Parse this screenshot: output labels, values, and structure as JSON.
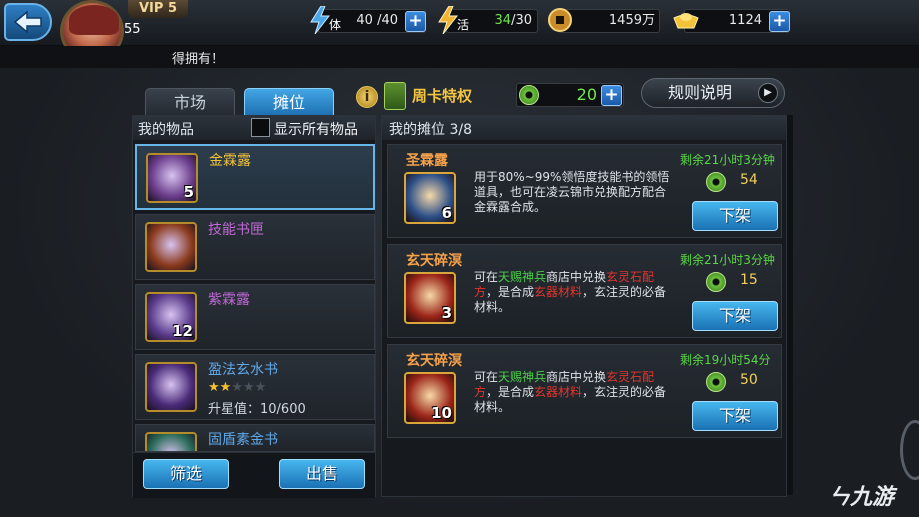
{
  "player": {
    "vip": "VIP 5",
    "level": "55"
  },
  "resources": {
    "stamina": {
      "icon": "stamina-icon",
      "label": "体",
      "value": "40 /40"
    },
    "vitality": {
      "icon": "vitality-icon",
      "label": "活",
      "current": "34",
      "max": "/30"
    },
    "copper": {
      "icon": "copper-coin-icon",
      "value": "1459万"
    },
    "gold": {
      "icon": "gold-ingot-icon",
      "value": "1124"
    }
  },
  "marquee": {
    "text": "得拥有！"
  },
  "tabs": [
    {
      "label": "市场",
      "active": false
    },
    {
      "label": "摊位",
      "active": true
    }
  ],
  "weekly_card": {
    "label": "周卡特权"
  },
  "jade_balance": {
    "value": "20"
  },
  "rules_button": {
    "label": "规则说明"
  },
  "left_panel": {
    "title": "我的物品",
    "show_all_label": "显示所有物品",
    "items": [
      {
        "name": "金霖露",
        "count": "5",
        "color": "#f4c33a",
        "selected": true,
        "icon_color": "#6a3c8a"
      },
      {
        "name": "技能书匣",
        "count": "",
        "color": "#c06ad6",
        "selected": false,
        "icon_color": "#8a3a1c"
      },
      {
        "name": "紫霖露",
        "count": "12",
        "color": "#c06ad6",
        "selected": false,
        "icon_color": "#5a3a8a"
      },
      {
        "name": "盈法玄水书",
        "count": "",
        "color": "#5fa8e8",
        "selected": false,
        "icon_color": "#4a2a78",
        "stars_on": 2,
        "stars_total": 5,
        "sub": "升星值：10/600"
      },
      {
        "name": "固盾素金书",
        "count": "",
        "color": "#5fa8e8",
        "selected": false,
        "icon_color": "#2a6a58"
      }
    ],
    "filter_button": "筛选",
    "sell_button": "出售"
  },
  "right_panel": {
    "title": "我的摊位 3/8",
    "stalls": [
      {
        "name": "圣霖露",
        "count": "6",
        "icon_color": "#2c4f88",
        "remain": "剩余21小时3分钟",
        "price": "54",
        "button": "下架",
        "desc": [
          {
            "t": "用于80%~99%领悟度技能书的领悟道具，也可在凌云锦市兑换配方配合金霖露合成。",
            "c": ""
          }
        ]
      },
      {
        "name": "玄天碎溟",
        "count": "3",
        "icon_color": "#9a2418",
        "remain": "剩余21小时3分钟",
        "price": "15",
        "button": "下架",
        "desc": [
          {
            "t": "可在",
            "c": ""
          },
          {
            "t": "天赐神兵",
            "c": "g"
          },
          {
            "t": "商店中兑换",
            "c": ""
          },
          {
            "t": "玄灵石配方",
            "c": "r"
          },
          {
            "t": "，是合成",
            "c": ""
          },
          {
            "t": "玄器材料",
            "c": "r"
          },
          {
            "t": "，玄注灵的必备材料。",
            "c": ""
          }
        ]
      },
      {
        "name": "玄天碎溟",
        "count": "10",
        "icon_color": "#9a2418",
        "remain": "剩余19小时54分",
        "price": "50",
        "button": "下架",
        "desc": [
          {
            "t": "可在",
            "c": ""
          },
          {
            "t": "天赐神兵",
            "c": "g"
          },
          {
            "t": "商店中兑换",
            "c": ""
          },
          {
            "t": "玄灵石配方",
            "c": "r"
          },
          {
            "t": "，是合成",
            "c": ""
          },
          {
            "t": "玄器材料",
            "c": "r"
          },
          {
            "t": "，玄注灵的必备材料。",
            "c": ""
          }
        ]
      }
    ]
  },
  "watermark": "九游"
}
